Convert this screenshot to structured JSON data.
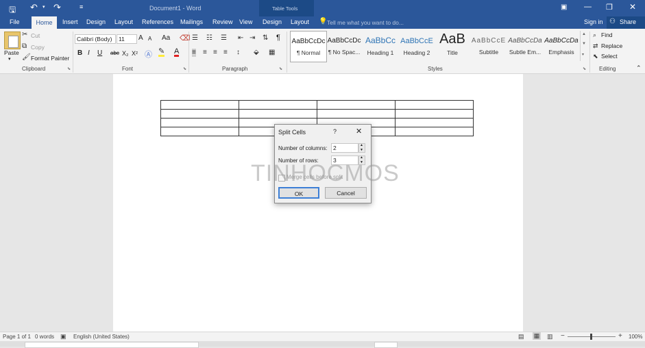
{
  "window": {
    "title": "Document1 - Word",
    "context_tab_group": "Table Tools",
    "sign_in": "Sign in",
    "share": "Share",
    "tell_me_placeholder": "Tell me what you want to do..."
  },
  "tabs": [
    "File",
    "Home",
    "Insert",
    "Design",
    "Layout",
    "References",
    "Mailings",
    "Review",
    "View",
    "Design",
    "Layout"
  ],
  "clipboard": {
    "paste": "Paste",
    "cut": "Cut",
    "copy": "Copy",
    "format_painter": "Format Painter",
    "label": "Clipboard"
  },
  "font": {
    "name": "Calibri (Body)",
    "size": "11",
    "label": "Font",
    "bold": "B",
    "italic": "I",
    "underline": "U",
    "strikethrough": "abc",
    "subscript": "X₂",
    "superscript": "X²",
    "grow": "A",
    "shrink": "A",
    "change_case": "Aa",
    "font_color": "A"
  },
  "paragraph": {
    "label": "Paragraph",
    "show_marks": "¶"
  },
  "styles": {
    "label": "Styles",
    "items": [
      {
        "sample": "AaBbCcDc",
        "name": "¶ Normal"
      },
      {
        "sample": "AaBbCcDc",
        "name": "¶ No Spac..."
      },
      {
        "sample": "AaBbCc",
        "name": "Heading 1"
      },
      {
        "sample": "AaBbCcE",
        "name": "Heading 2"
      },
      {
        "sample": "AaB",
        "name": "Title"
      },
      {
        "sample": "AaBbCcE",
        "name": "Subtitle"
      },
      {
        "sample": "AaBbCcDa",
        "name": "Subtle Em..."
      },
      {
        "sample": "AaBbCcDa",
        "name": "Emphasis"
      }
    ]
  },
  "editing": {
    "find": "Find",
    "replace": "Replace",
    "select": "Select",
    "label": "Editing"
  },
  "dialog": {
    "title": "Split Cells",
    "help": "?",
    "columns_label": "Number of columns:",
    "columns_value": "2",
    "rows_label": "Number of rows:",
    "rows_value": "3",
    "merge_label": "Merge cells before split",
    "ok": "OK",
    "cancel": "Cancel"
  },
  "watermark": "TINHOCMOS",
  "table": {
    "rows": 4,
    "columns": 4
  },
  "status": {
    "page": "Page 1 of 1",
    "words": "0 words",
    "language": "English (United States)",
    "zoom": "100%"
  },
  "colors": {
    "titlebar": "#2b579a",
    "context": "#1c4a86",
    "ribbon": "#f3f3f3"
  }
}
